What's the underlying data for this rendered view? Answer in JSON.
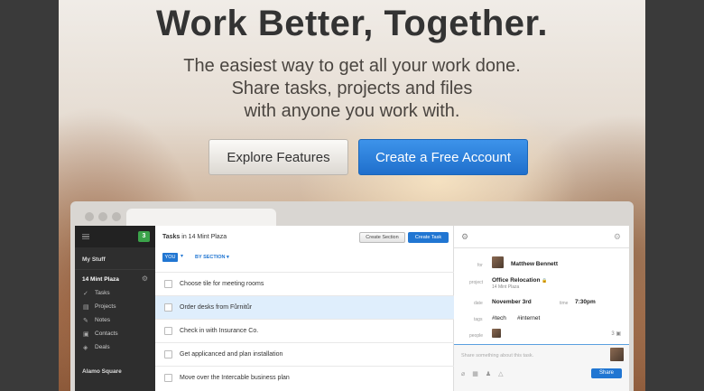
{
  "hero": {
    "headline": "Work Better, Together.",
    "sub1": "The easiest way to get all your work done.",
    "sub2": "Share tasks, projects and files",
    "sub3": "with anyone you work with.",
    "explore_label": "Explore Features",
    "create_label": "Create a Free Account"
  },
  "sidebar": {
    "badge": "3",
    "my_stuff": "My Stuff",
    "workspace": "14 Mint Plaza",
    "items": [
      {
        "label": "Tasks",
        "icon": "check-icon"
      },
      {
        "label": "Projects",
        "icon": "folder-icon"
      },
      {
        "label": "Notes",
        "icon": "pencil-icon"
      },
      {
        "label": "Contacts",
        "icon": "contacts-icon"
      },
      {
        "label": "Deals",
        "icon": "tag-icon"
      }
    ],
    "alamo": "Alamo Square"
  },
  "main": {
    "title_prefix": "Tasks",
    "title_in": " in 14 Mint Plaza",
    "create_section": "Create Section",
    "create_task": "Create Task",
    "you": "YOU",
    "by_section": "BY SECTION",
    "tasks": [
      "Choose tile for meeting rooms",
      "Order desks from Fůrnitůr",
      "Check in with Insurance Co.",
      "Get applicanced and plan installation",
      "Move over the Intercable business plan"
    ]
  },
  "detail": {
    "for_label": "for",
    "for_value": "Matthew Bennett",
    "project_label": "project",
    "project_value": "Office Relocation",
    "project_sub": "14 Mint Plaza",
    "date_label": "date",
    "date_value": "November 3rd",
    "time_label": "time",
    "time_value": "7:30pm",
    "tags_label": "tags",
    "tag1": "#tech",
    "tag2": "#internet",
    "people_label": "people",
    "people_count": "3",
    "share_placeholder": "Share something about this task.",
    "share_label": "Share"
  }
}
